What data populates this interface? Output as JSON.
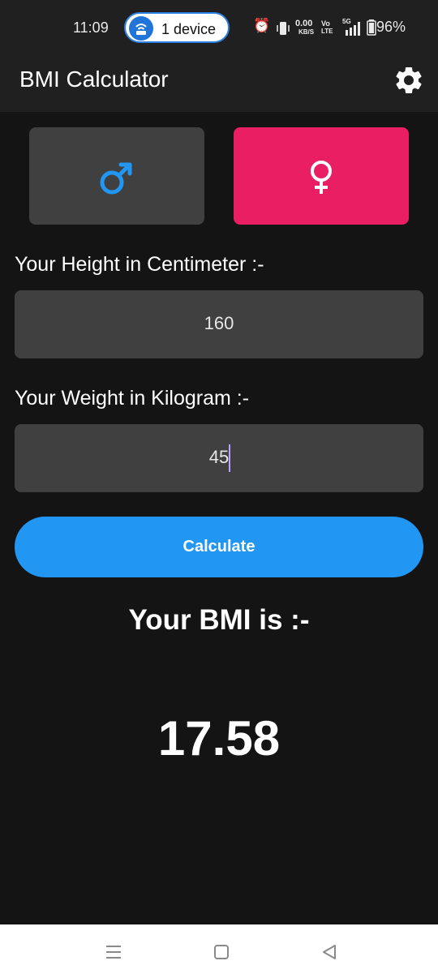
{
  "status_bar": {
    "time": "11:09",
    "device_pill": "1 device",
    "speed_value": "0.00",
    "speed_unit": "KB/S",
    "volte_top": "Vo",
    "volte_bottom": "LTE",
    "network": "5G",
    "battery": "96%"
  },
  "app_bar": {
    "title": "BMI Calculator",
    "settings_icon": "gear-icon"
  },
  "gender": {
    "male_icon": "male-symbol-icon",
    "female_icon": "female-symbol-icon",
    "male_color": "#2196f3",
    "female_bg": "#e91e63",
    "selected": "female"
  },
  "height": {
    "label": "Your Height in Centimeter :-",
    "value": "160"
  },
  "weight": {
    "label": "Your Weight in Kilogram :-",
    "value": "45"
  },
  "calculate": {
    "label": "Calculate",
    "color": "#2196f3"
  },
  "result": {
    "heading": "Your BMI is :-",
    "value": "17.58"
  },
  "nav_bar": {
    "recents_icon": "menu-icon",
    "home_icon": "home-icon",
    "back_icon": "back-icon"
  }
}
